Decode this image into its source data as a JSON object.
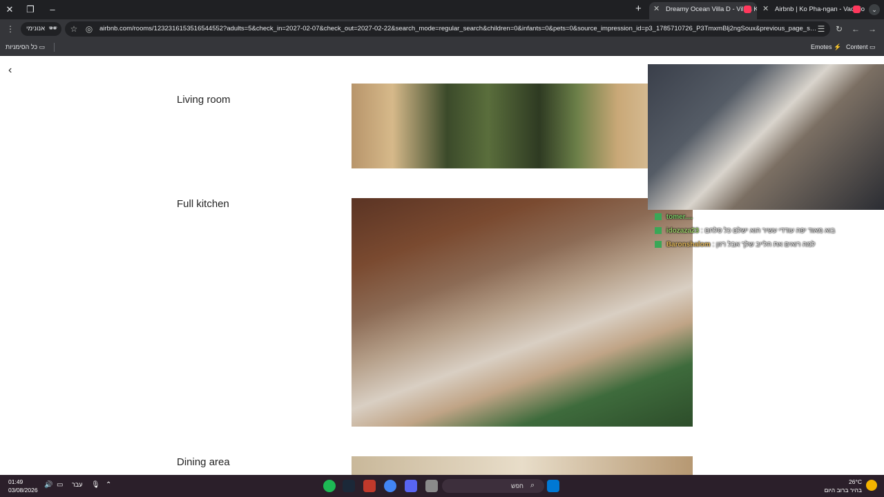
{
  "browser": {
    "tabs": [
      {
        "title": "Dreamy Ocean Villa D - Villas K",
        "active": true
      },
      {
        "title": "Airbnb | Ko Pha-ngan - Vacatio",
        "active": false
      }
    ],
    "incognito_label": "אנונימי",
    "url": "airbnb.com/rooms/1232316153516544552?adults=5&check_in=2027-02-07&check_out=2027-02-22&search_mode=regular_search&children=0&infants=0&pets=0&source_impression_id=p3_1785710726_P3TmxmBlj2ngSoux&previous_page_sectio...",
    "bookmarks_left": "כל הסימניות",
    "bookmarks_right": [
      "Emotes",
      "Content"
    ]
  },
  "page": {
    "rooms": [
      {
        "label": "Living room"
      },
      {
        "label": "Full kitchen"
      },
      {
        "label": "Dining area"
      }
    ]
  },
  "stream_chat": [
    {
      "user": "tomer....",
      "message": ""
    },
    {
      "user": "idozaza23",
      "message": ": בוא מאוד יפה עודדי עשיר הוא ישלם כל סלחם"
    },
    {
      "user": "Baronshalom",
      "message": ": למה רואים את הלייב שלך אבל רזון"
    }
  ],
  "taskbar": {
    "time": "01:49",
    "date": "03/08/2026",
    "language": "עבר",
    "search_placeholder": "חפש",
    "weather_temp": "26°C",
    "weather_desc": "בהיר ברוב היום"
  },
  "colors": {
    "titlebar": "#1f2023",
    "toolbar": "#35363a",
    "airbnb": "#ff385c",
    "taskbar": "#2b1f2a"
  }
}
